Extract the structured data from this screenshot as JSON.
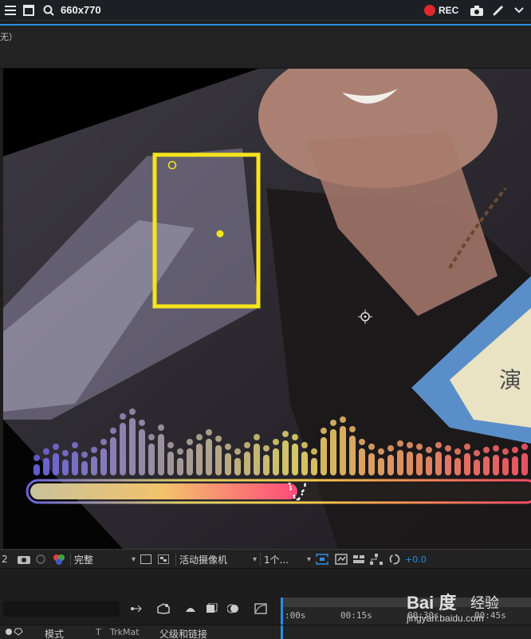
{
  "recorder": {
    "size_label": "660x770",
    "rec_label": "REC",
    "rec_color": "#e0282e"
  },
  "panel": {
    "tab_fragment": "无）"
  },
  "viewer": {
    "sign_text": "演",
    "box_color": "#f5e51c",
    "spectrum_level_percent": 53,
    "spectrum_colors": [
      "#6f66e8",
      "#e8d86a",
      "#ff4a6a"
    ]
  },
  "viewer_toolbar": {
    "layer_num": "2",
    "resolution": "完整",
    "camera": "活动摄像机",
    "views": "1个...",
    "exposure": "+0.0"
  },
  "timeline": {
    "ruler_times": [
      ":00s",
      "00:15s",
      "00:30s",
      "00:45s"
    ],
    "columns": {
      "mode": "模式",
      "t": "T",
      "trkmat": "TrkMat",
      "parent": "父级和链接"
    }
  },
  "watermark": {
    "logo": "Bai 度",
    "label": "经验",
    "url": "jingyan.baidu.com"
  }
}
